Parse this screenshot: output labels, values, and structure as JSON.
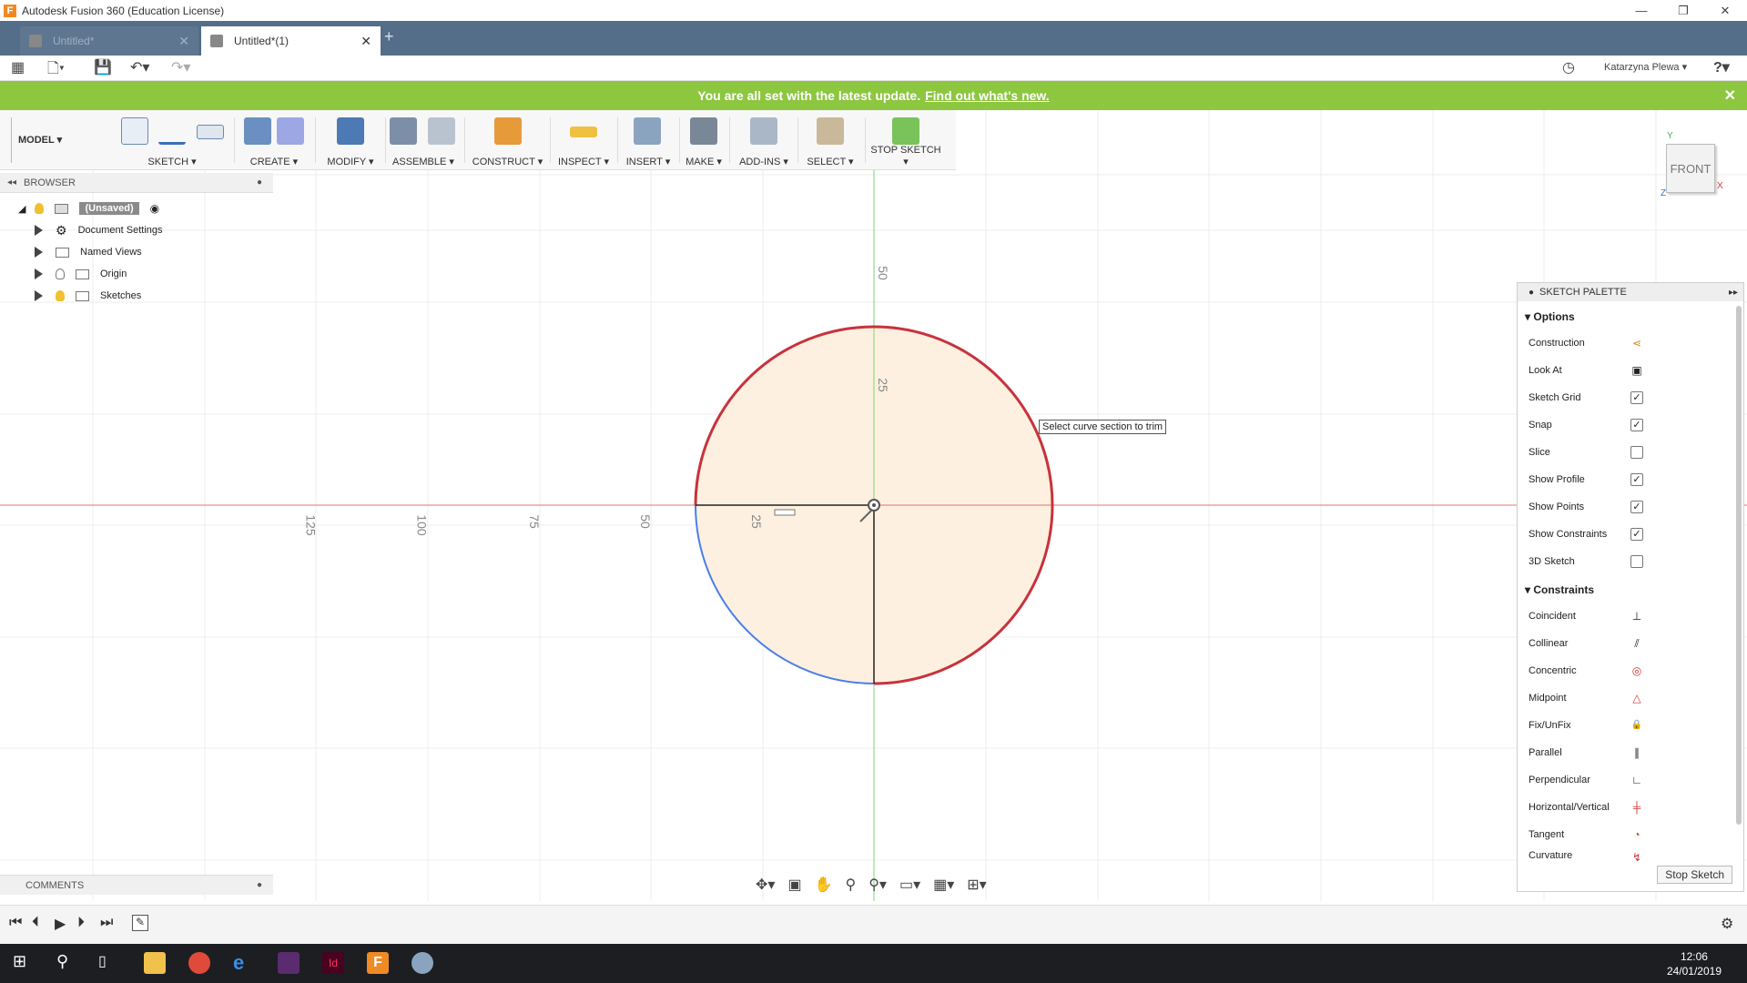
{
  "window": {
    "title": "Autodesk Fusion 360 (Education License)"
  },
  "tabs": [
    {
      "label": "Untitled*",
      "active": false
    },
    {
      "label": "Untitled*(1)",
      "active": true
    }
  ],
  "quick_access": {
    "user": "Katarzyna Plewa ▾",
    "help": "?"
  },
  "banner": {
    "message": "You are all set with the latest update.",
    "link": "Find out what's new."
  },
  "toolbar": {
    "workspace": "MODEL ▾",
    "groups": [
      "SKETCH ▾",
      "CREATE ▾",
      "MODIFY ▾",
      "ASSEMBLE ▾",
      "CONSTRUCT ▾",
      "INSPECT ▾",
      "INSERT ▾",
      "MAKE ▾",
      "ADD-INS ▾",
      "SELECT ▾",
      "STOP SKETCH ▾"
    ]
  },
  "browser": {
    "header": "BROWSER",
    "root": "(Unsaved)",
    "items": [
      "Document Settings",
      "Named Views",
      "Origin",
      "Sketches"
    ]
  },
  "comments": {
    "header": "COMMENTS"
  },
  "canvas": {
    "tooltip": "Select curve section to trim",
    "x_ticks": [
      "125",
      "100",
      "75",
      "50",
      "25"
    ],
    "y_ticks": [
      "50",
      "25"
    ],
    "viewcube": "FRONT",
    "axis_labels": {
      "y": "Y",
      "x": "X",
      "z": "Z"
    }
  },
  "sketch_palette": {
    "title": "SKETCH PALETTE",
    "options_header": "Options",
    "options": [
      {
        "label": "Construction",
        "type": "icon"
      },
      {
        "label": "Look At",
        "type": "icon"
      },
      {
        "label": "Sketch Grid",
        "type": "checkbox",
        "checked": true
      },
      {
        "label": "Snap",
        "type": "checkbox",
        "checked": true
      },
      {
        "label": "Slice",
        "type": "checkbox",
        "checked": false
      },
      {
        "label": "Show Profile",
        "type": "checkbox",
        "checked": true
      },
      {
        "label": "Show Points",
        "type": "checkbox",
        "checked": true
      },
      {
        "label": "Show Constraints",
        "type": "checkbox",
        "checked": true
      },
      {
        "label": "3D Sketch",
        "type": "checkbox",
        "checked": false
      }
    ],
    "constraints_header": "Constraints",
    "constraints": [
      {
        "label": "Coincident",
        "icon": "⊥"
      },
      {
        "label": "Collinear",
        "icon": "⫽"
      },
      {
        "label": "Concentric",
        "icon": "◎"
      },
      {
        "label": "Midpoint",
        "icon": "△"
      },
      {
        "label": "Fix/UnFix",
        "icon": "🔒"
      },
      {
        "label": "Parallel",
        "icon": "∥"
      },
      {
        "label": "Perpendicular",
        "icon": "∟"
      },
      {
        "label": "Horizontal/Vertical",
        "icon": "╪"
      },
      {
        "label": "Tangent",
        "icon": "◔"
      },
      {
        "label": "Curvature",
        "icon": "↯"
      }
    ],
    "stop_button": "Stop Sketch"
  },
  "taskbar": {
    "time": "12:06",
    "date": "24/01/2019"
  },
  "colors": {
    "accent_blue": "#546d88",
    "banner_green": "#8dc63f",
    "circle_red": "#c8323c",
    "circle_blue": "#4a7ee8",
    "profile_fill": "#fdf0e0"
  }
}
